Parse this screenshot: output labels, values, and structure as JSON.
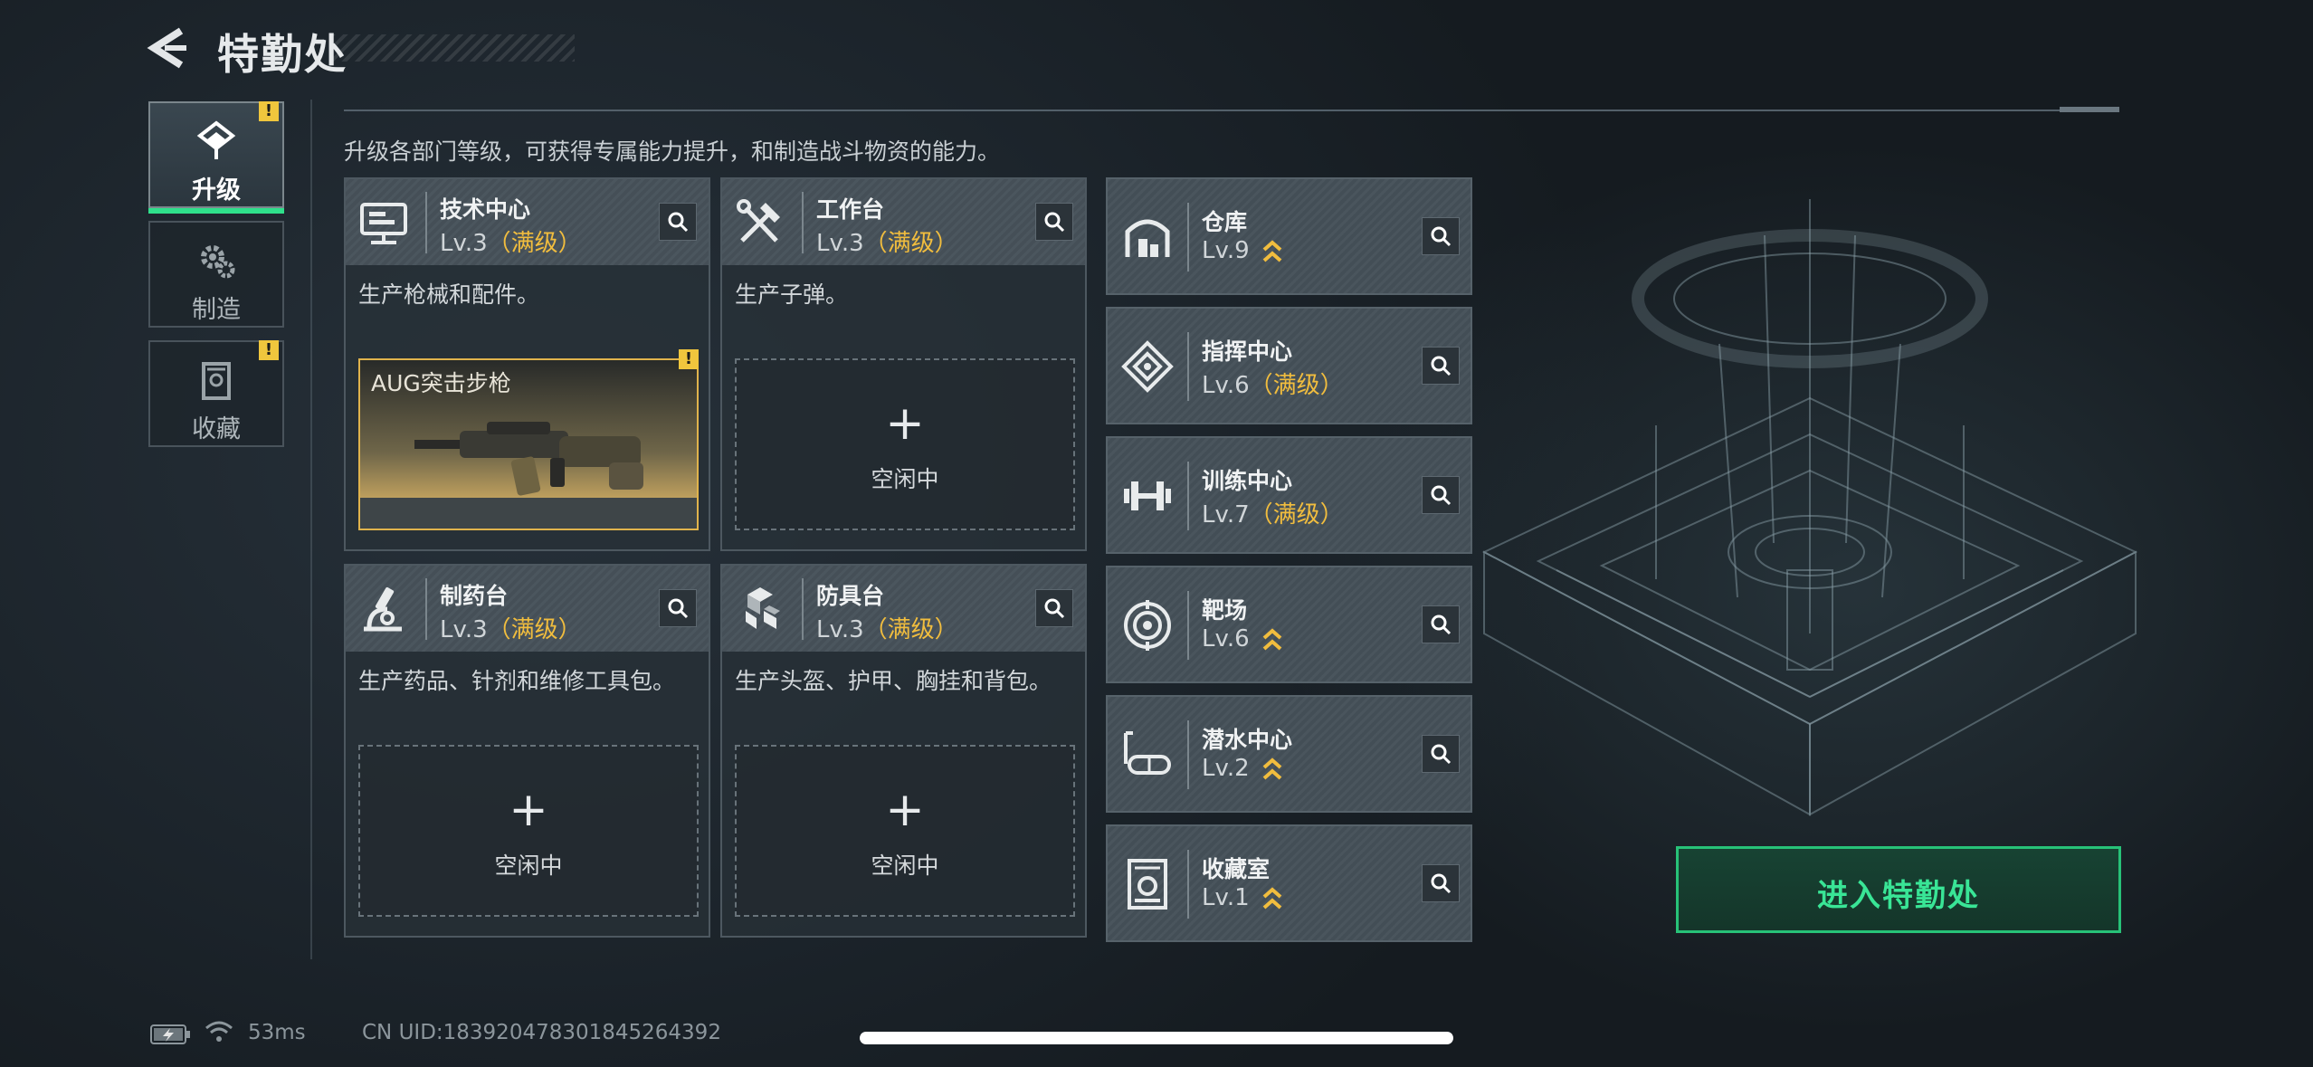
{
  "header": {
    "title": "特勤处",
    "back_icon": "back-arrow-icon"
  },
  "nav": {
    "items": [
      {
        "label": "升级",
        "icon": "upgrade-icon",
        "active": true,
        "badge": "!"
      },
      {
        "label": "制造",
        "icon": "gears-icon",
        "active": false
      },
      {
        "label": "收藏",
        "icon": "collection-icon",
        "active": false,
        "badge": "!"
      }
    ]
  },
  "description": "升级各部门等级，可获得专属能力提升，和制造战斗物资的能力。",
  "main_facilities": [
    {
      "name": "技术中心",
      "level": "Lv.3",
      "status": "（满级）",
      "desc": "生产枪械和配件。",
      "icon": "computer-icon",
      "slot": {
        "type": "item",
        "item_name": "AUG突击步枪",
        "badge": "!"
      }
    },
    {
      "name": "工作台",
      "level": "Lv.3",
      "status": "（满级）",
      "desc": "生产子弹。",
      "icon": "tools-icon",
      "slot": {
        "type": "idle",
        "plus": "+",
        "label": "空闲中"
      }
    },
    {
      "name": "制药台",
      "level": "Lv.3",
      "status": "（满级）",
      "desc": "生产药品、针剂和维修工具包。",
      "icon": "microscope-icon",
      "slot": {
        "type": "idle",
        "plus": "+",
        "label": "空闲中"
      }
    },
    {
      "name": "防具台",
      "level": "Lv.3",
      "status": "（满级）",
      "desc": "生产头盔、护甲、胸挂和背包。",
      "icon": "armor-cubes-icon",
      "slot": {
        "type": "idle",
        "plus": "+",
        "label": "空闲中"
      }
    }
  ],
  "side_facilities": [
    {
      "name": "仓库",
      "level": "Lv.9",
      "status": "",
      "icon": "warehouse-icon",
      "upgrade_indicator": true
    },
    {
      "name": "指挥中心",
      "level": "Lv.6",
      "status": "（满级）",
      "icon": "command-icon",
      "upgrade_indicator": false
    },
    {
      "name": "训练中心",
      "level": "Lv.7",
      "status": "（满级）",
      "icon": "dumbbell-icon",
      "upgrade_indicator": false
    },
    {
      "name": "靶场",
      "level": "Lv.6",
      "status": "",
      "icon": "target-icon",
      "upgrade_indicator": true
    },
    {
      "name": "潜水中心",
      "level": "Lv.2",
      "status": "",
      "icon": "diving-mask-icon",
      "upgrade_indicator": true
    },
    {
      "name": "收藏室",
      "level": "Lv.1",
      "status": "",
      "icon": "collection-room-icon",
      "upgrade_indicator": true
    }
  ],
  "enter_button": {
    "label": "进入特勤处"
  },
  "status_bar": {
    "ping": "53ms",
    "uid": "CN UID:18392047830184526​4392"
  },
  "colors": {
    "accent_green": "#2fe08b",
    "maxed_gold": "#f1bd3e",
    "badge_yellow": "#f0c63d"
  }
}
